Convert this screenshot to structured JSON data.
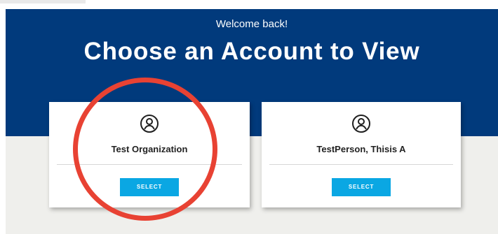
{
  "header": {
    "welcome": "Welcome back!",
    "title": "Choose an Account to View"
  },
  "accounts": [
    {
      "name": "Test Organization",
      "icon": "user-circle-icon",
      "button_label": "SELECT"
    },
    {
      "name": "TestPerson, Thisis A",
      "icon": "user-circle-icon",
      "button_label": "SELECT"
    }
  ],
  "annotation": {
    "type": "circle",
    "color": "#e84233",
    "target": "Test Organization"
  },
  "colors": {
    "header_bg": "#013a7c",
    "page_bg": "#efefec",
    "button_bg": "#0aa7e3",
    "card_bg": "#ffffff"
  }
}
